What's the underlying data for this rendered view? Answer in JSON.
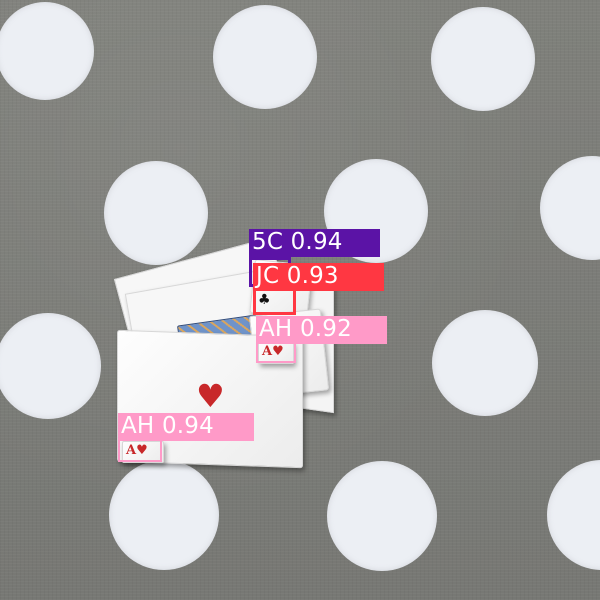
{
  "detections": [
    {
      "label": "5C 0.94",
      "class": "5C",
      "confidence": 0.94,
      "color": "#5b13a6"
    },
    {
      "label": "JC 0.93",
      "class": "JC",
      "confidence": 0.93,
      "color": "#ff3742"
    },
    {
      "label": "AH 0.92",
      "class": "AH",
      "confidence": 0.92,
      "color": "#ff9ac8"
    },
    {
      "label": "AH 0.94",
      "class": "AH",
      "confidence": 0.94,
      "color": "#ff9ac8"
    }
  ],
  "scene": {
    "background_color": "#7d7e7a",
    "dot_color": "#eceff4",
    "heart_color": "#c8282a"
  }
}
